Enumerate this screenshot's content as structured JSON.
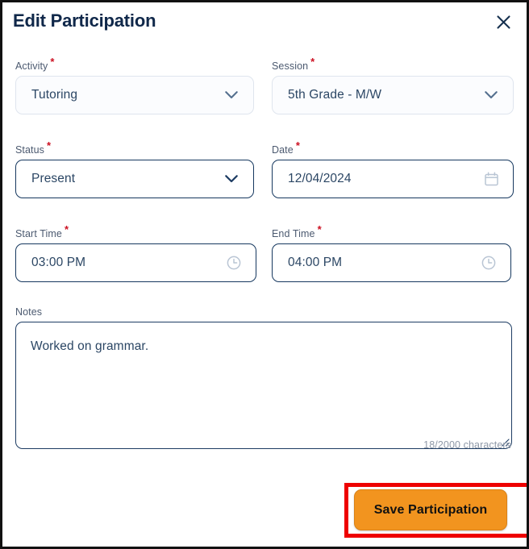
{
  "dialog": {
    "title": "Edit Participation",
    "close_icon": "close-icon"
  },
  "colors": {
    "title_navy": "#10284a",
    "border_navy": "#16385f",
    "border_light": "#dfe5ee",
    "required_red": "#cc1122",
    "accent_orange": "#f2941f",
    "highlight_red": "#ee0000",
    "value_text": "#2b4664",
    "label_text": "#4c5a70",
    "counter_text": "#8f99a8"
  },
  "fields": {
    "activity": {
      "label": "Activity",
      "required": "*",
      "value": "Tutoring",
      "icon": "chevron-down-icon"
    },
    "session": {
      "label": "Session",
      "required": "*",
      "value": "5th Grade - M/W",
      "icon": "chevron-down-icon"
    },
    "status": {
      "label": "Status",
      "required": "*",
      "value": "Present",
      "icon": "chevron-down-icon"
    },
    "date": {
      "label": "Date",
      "required": "*",
      "value": "12/04/2024",
      "icon": "calendar-icon"
    },
    "start_time": {
      "label": "Start Time",
      "required": "*",
      "value": "03:00 PM",
      "icon": "clock-icon"
    },
    "end_time": {
      "label": "End Time",
      "required": "*",
      "value": "04:00 PM",
      "icon": "clock-icon"
    },
    "notes": {
      "label": "Notes",
      "value": "Worked on grammar.",
      "placeholder": "",
      "char_count": "18/2000 characters",
      "max_length": "2000",
      "used_length": "18"
    }
  },
  "footer": {
    "save_label": "Save Participation"
  }
}
